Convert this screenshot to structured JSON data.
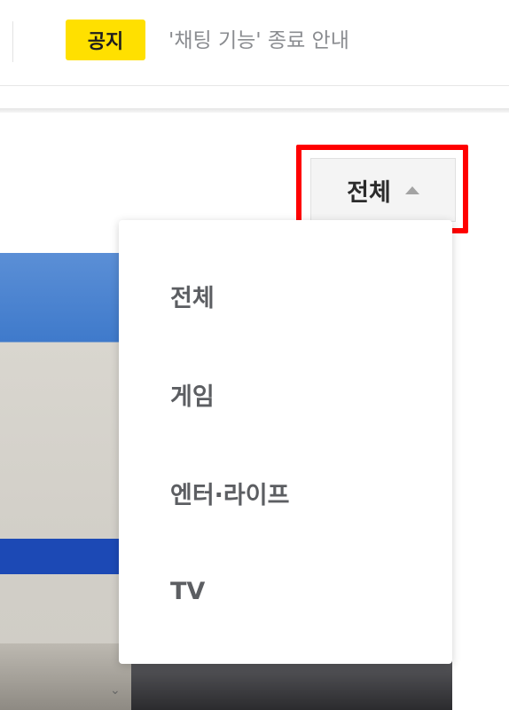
{
  "notice": {
    "badge": "공지",
    "text": "'채팅 기능' 종료 안내"
  },
  "filter": {
    "selected_label": "전체",
    "caret_icon": "caret-up-icon",
    "options": [
      {
        "label": "전체"
      },
      {
        "label": "게임"
      },
      {
        "label": "엔터·라이프"
      },
      {
        "label": "TV"
      }
    ]
  },
  "colors": {
    "notice_badge": "#ffe000",
    "highlight": "#ff0000",
    "menu_text": "#5c5e62"
  }
}
